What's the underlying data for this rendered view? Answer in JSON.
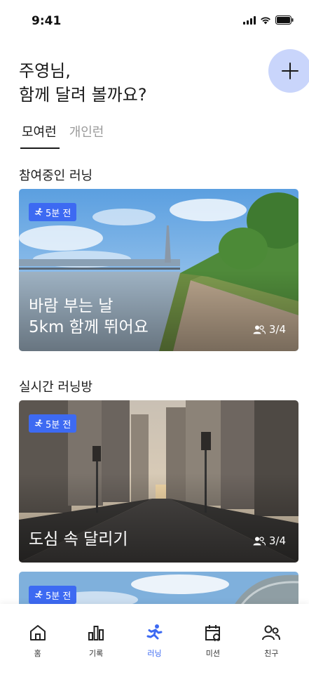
{
  "status_bar": {
    "time": "9:41"
  },
  "greeting": {
    "line1": "주영님,",
    "line2": "함께 달려 볼까요?"
  },
  "tabs": [
    {
      "label": "모여런",
      "active": true
    },
    {
      "label": "개인런",
      "active": false
    }
  ],
  "sections": {
    "joined": "참여중인 러닝",
    "live": "실시간 러닝방"
  },
  "cards": [
    {
      "badge": "5분 전",
      "title_line1": "바람 부는 날",
      "title_line2": "5km 함께 뛰어요",
      "participants": "3/4"
    },
    {
      "badge": "5분 전",
      "title_line1": "도심 속 달리기",
      "participants": "3/4"
    },
    {
      "badge": "5분 전"
    }
  ],
  "nav": [
    {
      "label": "홈",
      "icon": "home-icon"
    },
    {
      "label": "기록",
      "icon": "chart-icon"
    },
    {
      "label": "러닝",
      "icon": "runner-icon",
      "active": true
    },
    {
      "label": "미션",
      "icon": "calendar-icon"
    },
    {
      "label": "친구",
      "icon": "friends-icon"
    }
  ],
  "colors": {
    "accent": "#3d6af2",
    "fab": "#c9d5fb"
  }
}
